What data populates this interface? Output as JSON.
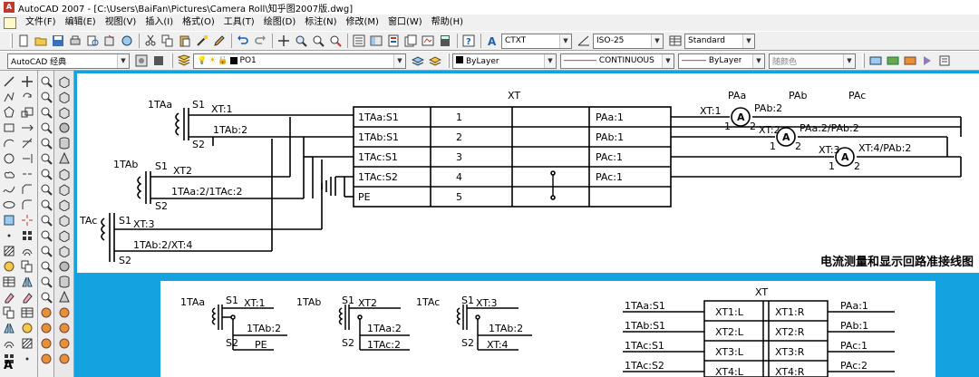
{
  "window": {
    "title": "AutoCAD 2007 - [C:\\Users\\BaiFan\\Pictures\\Camera Roll\\知乎图2007版.dwg]"
  },
  "menu": [
    "文件(F)",
    "编辑(E)",
    "视图(V)",
    "插入(I)",
    "格式(O)",
    "工具(T)",
    "绘图(D)",
    "标注(N)",
    "修改(M)",
    "窗口(W)",
    "帮助(H)"
  ],
  "toolbar1": {
    "text_style": "CTXT",
    "dim_style": "ISO-25",
    "table_style": "Standard"
  },
  "toolbar2": {
    "workspace": "AutoCAD 经典",
    "layer": "PO1",
    "color": "ByLayer",
    "linetype": "CONTINUOUS",
    "lineweight": "ByLayer",
    "plot_style": "随颜色"
  },
  "left_palette": {
    "bottom_label": "A"
  },
  "diagram1": {
    "caption": "电流测量和显示回路准接线图",
    "header": "XT",
    "ct_labels": [
      "1TAa",
      "1TAb",
      "TAc"
    ],
    "ct1": {
      "s1": "S1",
      "s2": "S2",
      "w1": "XT:1",
      "w2": "1TAb:2"
    },
    "ct2": {
      "s1": "S1",
      "s2": "S2",
      "w1": "XT2",
      "w2": "1TAa:2/1TAc:2"
    },
    "ct3": {
      "s1": "S1",
      "s2": "S2",
      "w1": "XT:3",
      "w2": "1TAb:2/XT:4"
    },
    "rows": [
      {
        "left": "1TAa:S1",
        "num": "1",
        "right": "PAa:1"
      },
      {
        "left": "1TAb:S1",
        "num": "2",
        "right": "PAb:1"
      },
      {
        "left": "1TAc:S1",
        "num": "3",
        "right": "PAc:1"
      },
      {
        "left": "1TAc:S2",
        "num": "4",
        "right": "PAc:1"
      },
      {
        "left": "PE",
        "num": "5",
        "right": ""
      }
    ],
    "meter_headers": [
      "PAa",
      "PAb",
      "PAc"
    ],
    "meters": [
      {
        "in": "XT:1",
        "out": "PAb:2",
        "symbol": "A",
        "p1": "1",
        "p2": "2"
      },
      {
        "in": "XT:2",
        "out": "PAa:2/PAb:2",
        "symbol": "A",
        "p1": "1",
        "p2": "2"
      },
      {
        "in": "XT:3",
        "out": "XT:4/PAb:2",
        "symbol": "A",
        "p1": "1",
        "p2": "2"
      }
    ]
  },
  "diagram2": {
    "header": "XT",
    "cts": [
      {
        "label": "1TAa",
        "s1": "S1",
        "s2": "S2",
        "w1": "XT:1",
        "w2": "1TAb:2",
        "w3": "PE"
      },
      {
        "label": "1TAb",
        "s1": "S1",
        "s2": "S2",
        "w1": "XT2",
        "w2": "1TAa:2",
        "w3": "1TAc:2"
      },
      {
        "label": "1TAc",
        "s1": "S1",
        "s2": "S2",
        "w1": "XT:3",
        "w2": "1TAb:2",
        "w3": "XT:4"
      }
    ],
    "rows": [
      {
        "left": "1TAa:S1",
        "l": "XT1:L",
        "r": "XT1:R",
        "right": "PAa:1"
      },
      {
        "left": "1TAb:S1",
        "l": "XT2:L",
        "r": "XT2:R",
        "right": "PAb:1"
      },
      {
        "left": "1TAc:S1",
        "l": "XT3:L",
        "r": "XT3:R",
        "right": "PAc:1"
      },
      {
        "left": "1TAc:S2",
        "l": "XT4:L",
        "r": "XT4:R",
        "right": "PAc:2"
      }
    ]
  },
  "colors": {
    "drawing_background": "#14a3e0",
    "sheet": "#ffffff",
    "chrome": "#f0f0f0"
  }
}
